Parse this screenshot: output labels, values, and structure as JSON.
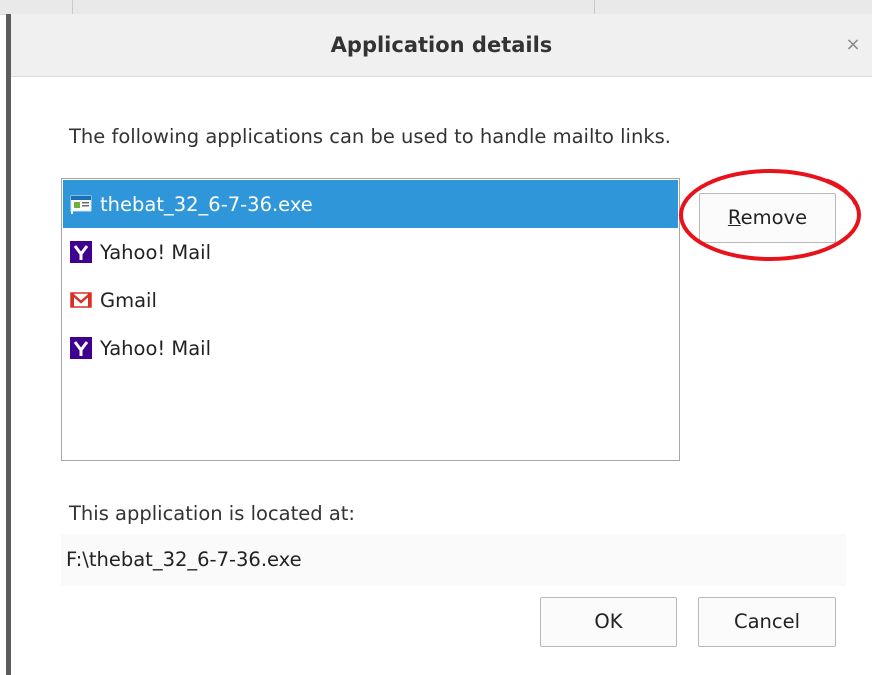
{
  "dialog": {
    "title": "Application details",
    "close_label": "×",
    "description": "The following applications can be used to handle mailto links.",
    "applications": [
      {
        "label": "thebat_32_6-7-36.exe",
        "icon": "executable-icon",
        "selected": true
      },
      {
        "label": "Yahoo! Mail",
        "icon": "yahoo-icon",
        "selected": false
      },
      {
        "label": "Gmail",
        "icon": "gmail-icon",
        "selected": false
      },
      {
        "label": "Yahoo! Mail",
        "icon": "yahoo-icon",
        "selected": false
      }
    ],
    "remove_button": {
      "accel": "R",
      "rest": "emove"
    },
    "location_label": "This application is located at:",
    "location_value": "F:\\thebat_32_6-7-36.exe",
    "ok_label": "OK",
    "cancel_label": "Cancel"
  },
  "colors": {
    "selection": "#2f96d9",
    "highlight_ring": "#e8121a",
    "yahoo": "#400191",
    "gmail": "#d93025"
  }
}
